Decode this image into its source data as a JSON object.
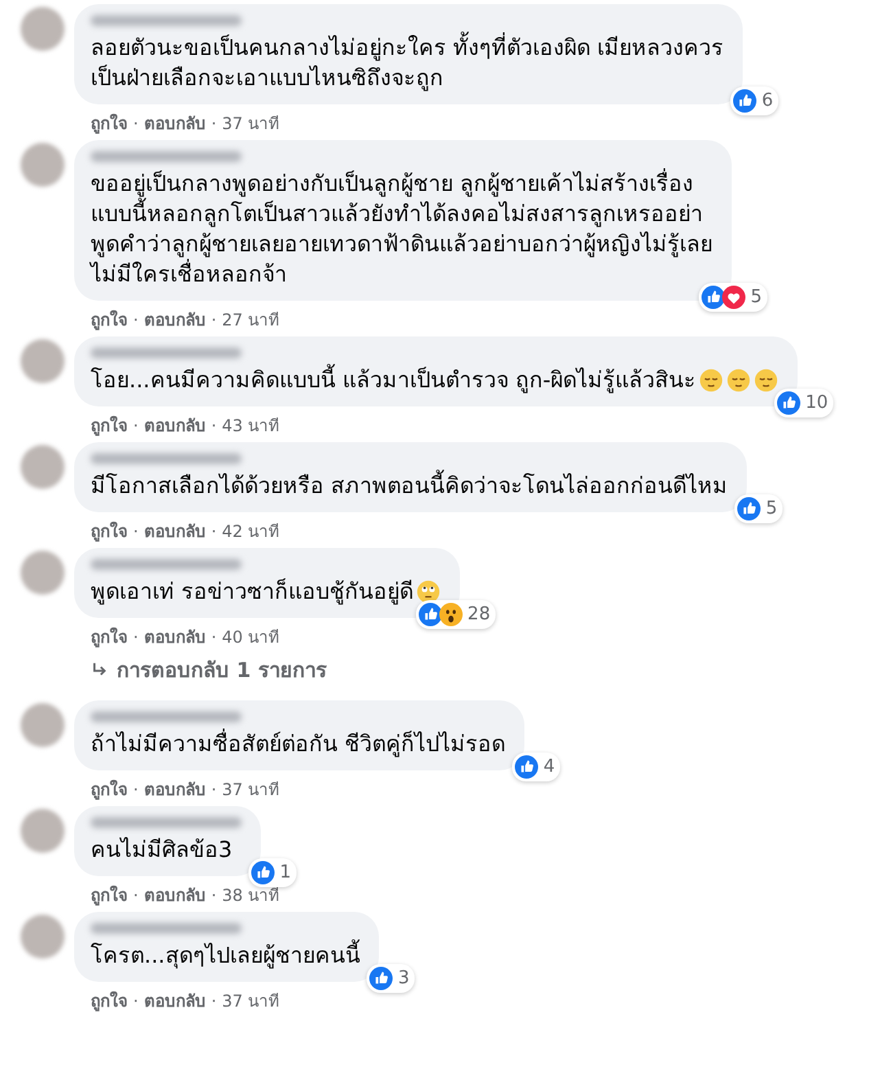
{
  "comments": [
    {
      "text": "ลอยตัวนะขอเป็นคนกลางไม่อยู่กะใคร ทั้งๆที่ตัวเองผิด เมียหลวงควร\nเป็นฝ่ายเลือกจะเอาแบบไหนซิถึงจะถูก",
      "reactions": [
        {
          "kind": "like"
        }
      ],
      "reaction_count": "6",
      "like": "ถูกใจ",
      "sep1": "·",
      "reply": "ตอบกลับ",
      "sep2": "·",
      "time": "37 นาที"
    },
    {
      "text": "ขออยู่เป็นกลางพูดอย่างกับเป็นลูกผู้ชาย ลูกผู้ชายเค้าไม่สร้างเรื่อง\nแบบนี้หลอกลูกโตเป็นสาวแล้วยังทำได้ลงคอไม่สงสารลูกเหรออย่า\nพูดคำว่าลูกผู้ชายเลยอายเทวดาฟ้าดินแล้วอย่าบอกว่าผู้หญิงไม่รู้เลย\nไม่มีใครเชื่อหลอกจ้า",
      "reactions": [
        {
          "kind": "like"
        },
        {
          "kind": "love"
        }
      ],
      "reaction_count": "5",
      "like": "ถูกใจ",
      "sep1": "·",
      "reply": "ตอบกลับ",
      "sep2": "·",
      "time": "27 นาที"
    },
    {
      "text": "โอย...คนมีความคิดแบบนี้ แล้วมาเป็นตำรวจ ถูก-ผิดไม่รู้แล้วสินะ",
      "emoji": [
        {
          "kind": "relieved"
        },
        {
          "kind": "relieved"
        },
        {
          "kind": "relieved"
        }
      ],
      "reactions": [
        {
          "kind": "like"
        }
      ],
      "reaction_count": "10",
      "like": "ถูกใจ",
      "sep1": "·",
      "reply": "ตอบกลับ",
      "sep2": "·",
      "time": "43 นาที"
    },
    {
      "text": "มีโอกาสเลือกได้ด้วยหรือ สภาพตอนนี้คิดว่าจะโดนไล่ออกก่อนดีไหม",
      "reactions": [
        {
          "kind": "like"
        }
      ],
      "reaction_count": "5",
      "like": "ถูกใจ",
      "sep1": "·",
      "reply": "ตอบกลับ",
      "sep2": "·",
      "time": "42 นาที"
    },
    {
      "text": "พูดเอาเท่ รอข่าวซาก็แอบชู้กันอยู่ดี",
      "emoji": [
        {
          "kind": "rolling-eyes"
        }
      ],
      "reactions": [
        {
          "kind": "like"
        },
        {
          "kind": "wow"
        }
      ],
      "reaction_count": "28",
      "like": "ถูกใจ",
      "sep1": "·",
      "reply": "ตอบกลับ",
      "sep2": "·",
      "time": "40 นาที",
      "replies_link": "การตอบกลับ 1 รายการ"
    },
    {
      "text": "ถ้าไม่มีความซื่อสัตย์ต่อกัน ชีวิตคู่ก็ไปไม่รอด",
      "reactions": [
        {
          "kind": "like"
        }
      ],
      "reaction_count": "4",
      "like": "ถูกใจ",
      "sep1": "·",
      "reply": "ตอบกลับ",
      "sep2": "·",
      "time": "37 นาที"
    },
    {
      "text": "คนไม่มีศิลข้อ3",
      "reactions": [
        {
          "kind": "like"
        }
      ],
      "reaction_count": "1",
      "like": "ถูกใจ",
      "sep1": "·",
      "reply": "ตอบกลับ",
      "sep2": "·",
      "time": "38 นาที"
    },
    {
      "text": "โครต...สุดๆไปเลยผู้ชายคนนี้",
      "reactions": [
        {
          "kind": "like"
        }
      ],
      "reaction_count": "3",
      "like": "ถูกใจ",
      "sep1": "·",
      "reply": "ตอบกลับ",
      "sep2": "·",
      "time": "37 นาที"
    }
  ]
}
